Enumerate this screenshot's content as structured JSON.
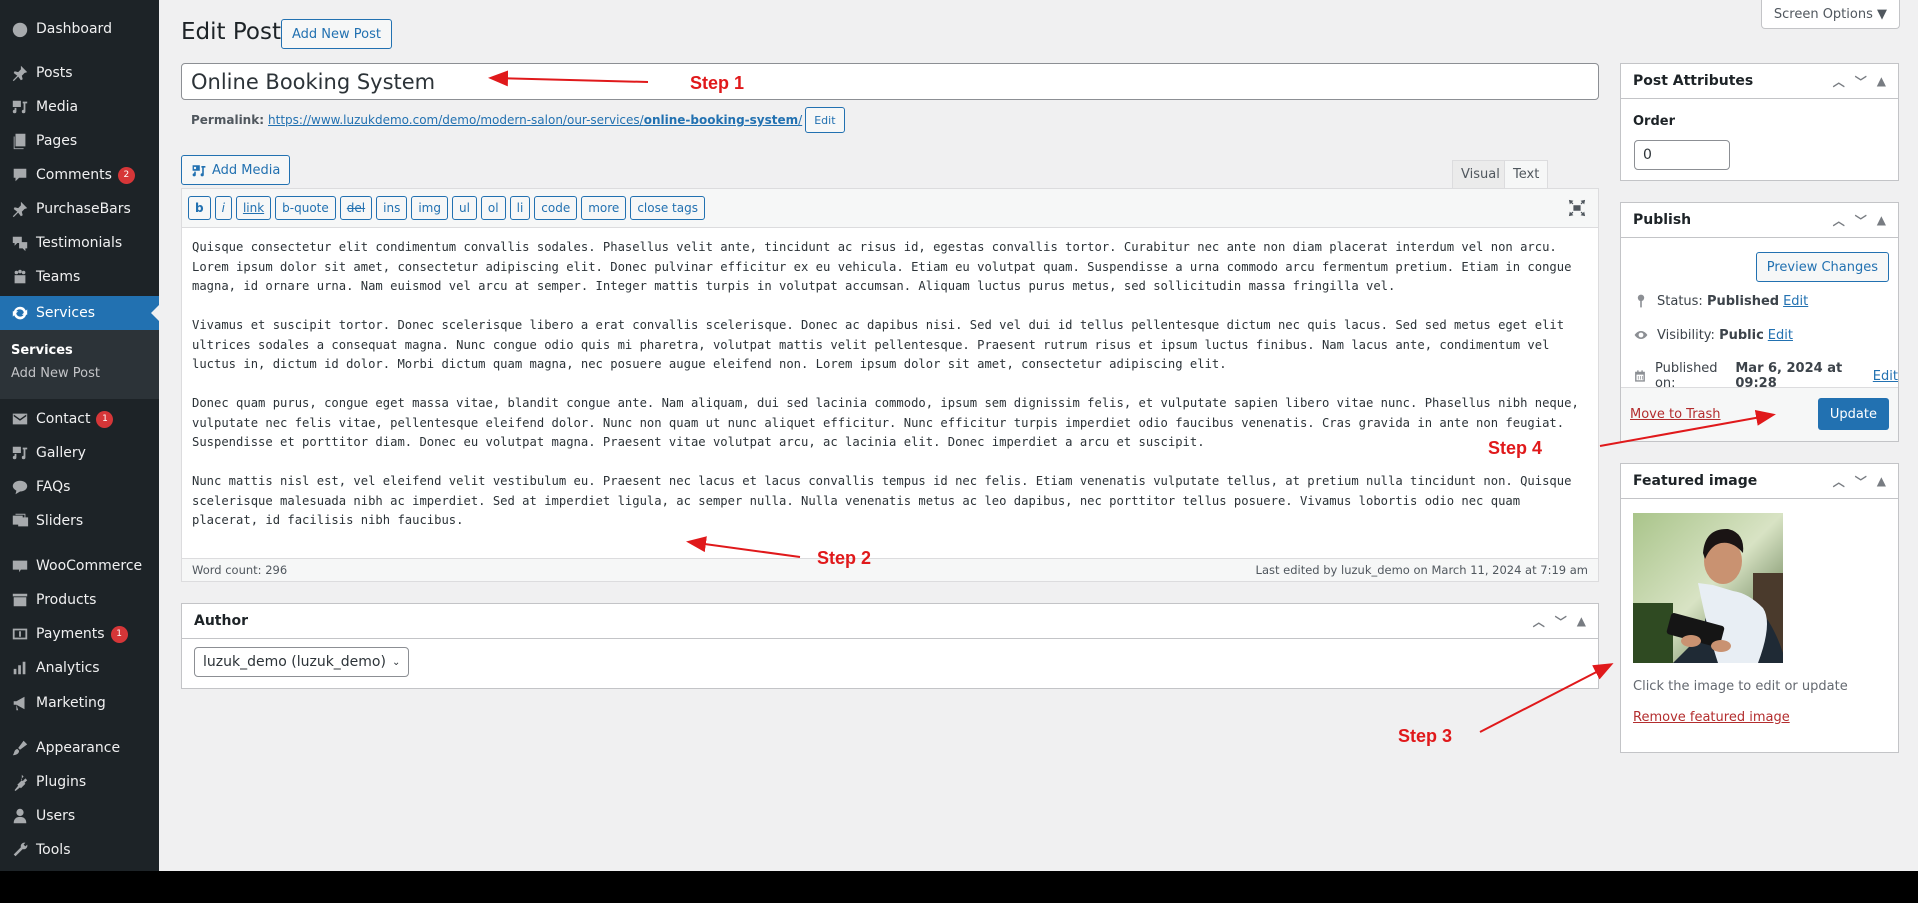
{
  "sidebar": {
    "items": [
      {
        "label": "Dashboard",
        "icon": "dashboard-icon"
      },
      {
        "label": "Posts",
        "icon": "pin-icon"
      },
      {
        "label": "Media",
        "icon": "media-icon"
      },
      {
        "label": "Pages",
        "icon": "pages-icon"
      },
      {
        "label": "Comments",
        "icon": "comment-icon",
        "badge": "2"
      },
      {
        "label": "PurchaseBars",
        "icon": "pin-icon"
      },
      {
        "label": "Testimonials",
        "icon": "testimonial-icon"
      },
      {
        "label": "Teams",
        "icon": "groups-icon"
      },
      {
        "label": "Services",
        "icon": "update-icon",
        "active": true
      },
      {
        "label": "Contact",
        "icon": "email-icon",
        "badge": "1"
      },
      {
        "label": "Gallery",
        "icon": "media-icon"
      },
      {
        "label": "FAQs",
        "icon": "chat-icon"
      },
      {
        "label": "Sliders",
        "icon": "images-icon"
      },
      {
        "label": "WooCommerce",
        "icon": "woo-icon"
      },
      {
        "label": "Products",
        "icon": "archive-icon"
      },
      {
        "label": "Payments",
        "icon": "dollar-icon",
        "badge": "1"
      },
      {
        "label": "Analytics",
        "icon": "chart-icon"
      },
      {
        "label": "Marketing",
        "icon": "megaphone-icon"
      },
      {
        "label": "Appearance",
        "icon": "brush-icon"
      },
      {
        "label": "Plugins",
        "icon": "plugin-icon"
      },
      {
        "label": "Users",
        "icon": "user-icon"
      },
      {
        "label": "Tools",
        "icon": "wrench-icon"
      }
    ],
    "submenu": [
      {
        "label": "Services",
        "current": true
      },
      {
        "label": "Add New Post",
        "current": false
      }
    ]
  },
  "header": {
    "title": "Edit Post",
    "add_new": "Add New Post",
    "screen_options": "Screen Options ▼"
  },
  "post": {
    "title": "Online Booking System",
    "permalink_label": "Permalink:",
    "permalink_base": "https://www.luzukdemo.com/demo/modern-salon/our-services/",
    "permalink_slug": "online-booking-system",
    "permalink_end": "/",
    "permalink_edit": "Edit"
  },
  "editor": {
    "add_media": "Add Media",
    "tabs": {
      "visual": "Visual",
      "text": "Text",
      "active": "Text"
    },
    "quicktags": [
      "b",
      "i",
      "link",
      "b-quote",
      "del",
      "ins",
      "img",
      "ul",
      "ol",
      "li",
      "code",
      "more",
      "close tags"
    ],
    "paragraphs": [
      "Quisque consectetur elit condimentum convallis sodales. Phasellus velit ante, tincidunt ac risus id, egestas convallis tortor. Curabitur nec ante non diam placerat interdum vel non arcu. Lorem ipsum dolor sit amet, consectetur adipiscing elit. Donec pulvinar efficitur ex eu vehicula. Etiam eu volutpat quam. Suspendisse a urna commodo arcu fermentum pretium. Etiam in congue magna, id ornare urna. Nam euismod vel arcu at semper. Integer mattis turpis in volutpat accumsan. Aliquam luctus purus metus, sed sollicitudin massa fringilla vel.",
      "Vivamus et suscipit tortor. Donec scelerisque libero a erat convallis scelerisque. Donec ac dapibus nisi. Sed vel dui id tellus pellentesque dictum nec quis lacus. Sed sed metus eget elit ultrices sodales a consequat magna. Nunc congue odio quis mi pharetra, volutpat mattis velit pellentesque. Praesent rutrum risus et ipsum luctus finibus. Nam lacus ante, condimentum vel luctus in, dictum id dolor. Morbi dictum quam magna, nec posuere augue eleifend non. Lorem ipsum dolor sit amet, consectetur adipiscing elit.",
      "Donec quam purus, congue eget massa vitae, blandit congue ante. Nam aliquam, dui sed lacinia commodo, ipsum sem dignissim felis, et vulputate sapien libero vitae nunc. Phasellus nibh neque, vulputate nec felis vitae, pellentesque eleifend dolor. Nunc non quam ut nunc aliquet efficitur. Nunc efficitur turpis imperdiet odio faucibus venenatis. Cras gravida in ante non feugiat. Suspendisse et porttitor diam. Donec eu volutpat magna. Praesent vitae volutpat arcu, ac lacinia elit. Donec imperdiet a arcu et suscipit.",
      "Nunc mattis nisl est, vel eleifend velit vestibulum eu. Praesent nec lacus et lacus convallis tempus id nec felis. Etiam venenatis vulputate tellus, at pretium nulla tincidunt non. Quisque scelerisque malesuada nibh ac imperdiet. Sed at imperdiet ligula, ac semper nulla. Nulla venenatis metus ac leo dapibus, nec porttitor tellus posuere. Vivamus lobortis odio nec quam placerat, id facilisis nibh faucibus."
    ],
    "word_count": "Word count: 296",
    "last_edited": "Last edited by luzuk_demo on March 11, 2024 at 7:19 am"
  },
  "author_box": {
    "title": "Author",
    "selected": "luzuk_demo (luzuk_demo)"
  },
  "post_attributes": {
    "title": "Post Attributes",
    "order_label": "Order",
    "order_value": "0"
  },
  "publish": {
    "title": "Publish",
    "preview": "Preview Changes",
    "status_label": "Status:",
    "status_value": "Published",
    "visibility_label": "Visibility:",
    "visibility_value": "Public",
    "published_label": "Published on:",
    "published_value": "Mar 6, 2024 at 09:28",
    "edit": "Edit",
    "trash": "Move to Trash",
    "update": "Update"
  },
  "featured_image": {
    "title": "Featured image",
    "hint": "Click the image to edit or update",
    "remove": "Remove featured image"
  },
  "annotations": {
    "step1": "Step 1",
    "step2": "Step 2",
    "step3": "Step 3",
    "step4": "Step 4",
    "color": "#e0191b"
  }
}
